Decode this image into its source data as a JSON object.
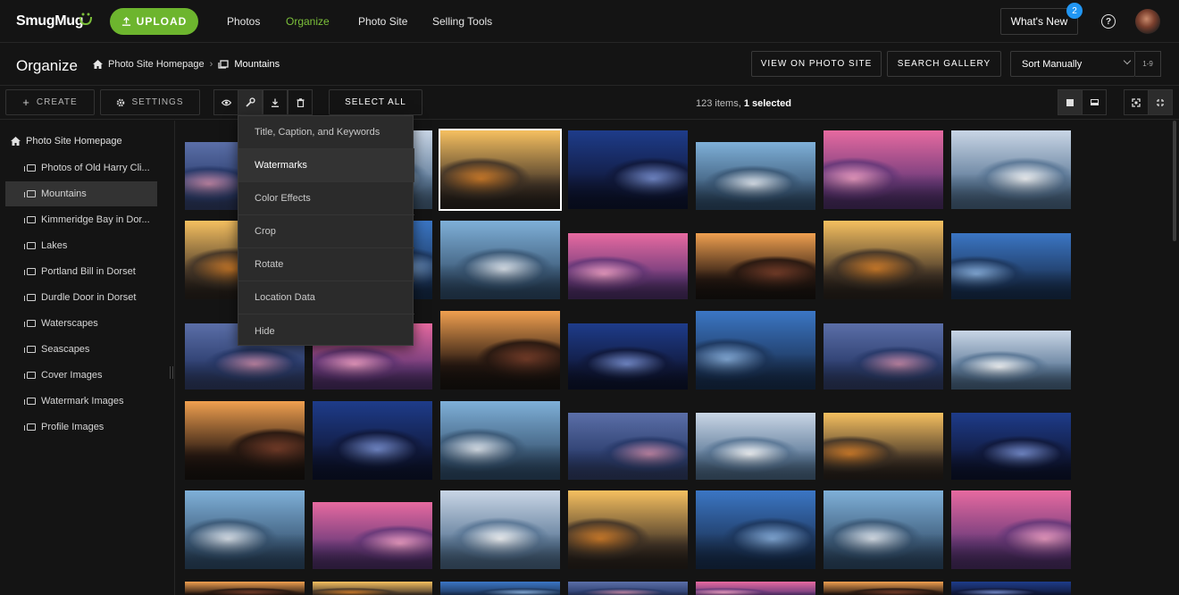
{
  "topnav": {
    "logo": "SmugMug",
    "upload_label": "UPLOAD",
    "links": [
      "Photos",
      "Organize",
      "Photo Site",
      "Selling Tools"
    ],
    "active_link": "Organize",
    "whats_new_label": "What's New",
    "whats_new_badge": "2",
    "help_glyph": "?",
    "accent_color": "#6db52e",
    "badge_color": "#2196f3"
  },
  "subbar": {
    "title": "Organize",
    "breadcrumb": [
      "Photo Site Homepage",
      "Mountains"
    ],
    "view_on_site_label": "VIEW ON PHOTO SITE",
    "search_gallery_label": "SEARCH GALLERY",
    "sort_value": "Sort Manually",
    "sort_order": "1-9"
  },
  "toolbar": {
    "create_label": "CREATE",
    "settings_label": "SETTINGS",
    "select_all_label": "SELECT ALL",
    "items_count": "123 items,",
    "selected_count": "1 selected",
    "icons": [
      "eye-icon",
      "wrench-icon",
      "download-icon",
      "trash-icon"
    ]
  },
  "sidebar": {
    "home": "Photo Site Homepage",
    "items": [
      {
        "label": "Photos of Old Harry Cli..."
      },
      {
        "label": "Mountains",
        "selected": true
      },
      {
        "label": "Kimmeridge Bay in Dor..."
      },
      {
        "label": "Lakes"
      },
      {
        "label": "Portland Bill in Dorset"
      },
      {
        "label": "Durdle Door in Dorset"
      },
      {
        "label": "Waterscapes"
      },
      {
        "label": "Seascapes"
      },
      {
        "label": "Cover Images"
      },
      {
        "label": "Watermark Images"
      },
      {
        "label": "Profile Images"
      }
    ]
  },
  "dropdown": {
    "items": [
      "Title, Caption, and Keywords",
      "Watermarks",
      "Color Effects",
      "Crop",
      "Rotate",
      "Location Data",
      "Hide"
    ],
    "highlighted": "Watermarks"
  }
}
